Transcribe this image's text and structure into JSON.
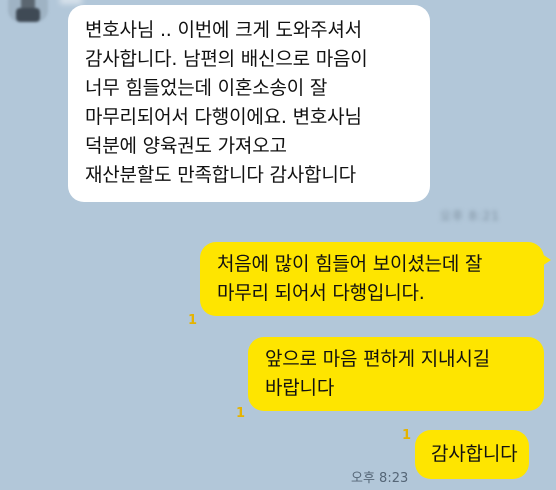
{
  "chat": {
    "incoming": {
      "lines": [
        "변호사님 .. 이번에 크게 도와주셔서",
        "감사합니다. 남편의 배신으로 마음이",
        "너무 힘들었는데 이혼소송이 잘",
        "마무리되어서 다행이에요. 변호사님",
        "덕분에 양육권도 가져오고",
        "재산분할도 만족합니다 감사합니다"
      ],
      "blurred_meta": "오후 8:21"
    },
    "outgoing": [
      {
        "lines": [
          "처음에 많이 힘들어 보이셨는데 잘",
          "마무리 되어서 다행입니다."
        ],
        "unread": "1"
      },
      {
        "lines": [
          "앞으로 마음 편하게 지내시길",
          "바랍니다"
        ],
        "unread": "1"
      },
      {
        "lines": [
          "감사합니다"
        ],
        "unread": "1",
        "time": "오후 8:23"
      }
    ]
  },
  "colors": {
    "background": "#b2c7d9",
    "incoming_bubble": "#ffffff",
    "outgoing_bubble": "#fee500",
    "unread_count": "#e5b300"
  },
  "icons": {
    "avatar": "profile-avatar (blurred)"
  }
}
